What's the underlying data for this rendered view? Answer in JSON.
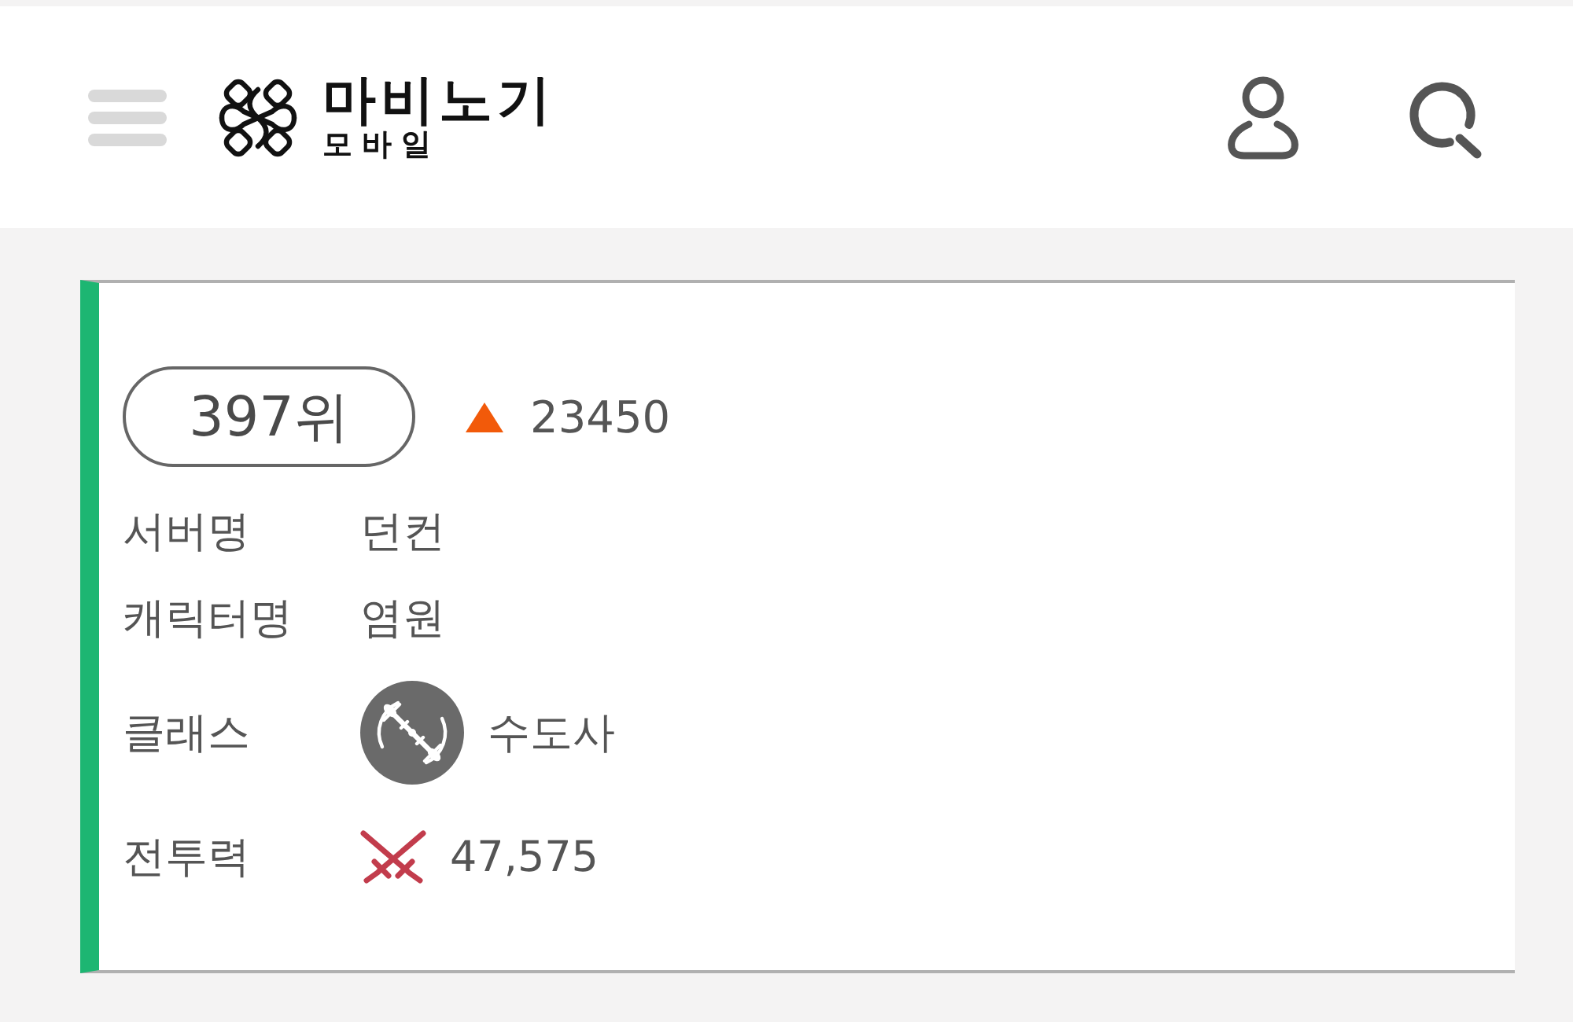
{
  "header": {
    "logo": {
      "title": "마비노기",
      "subtitle": "모바일"
    }
  },
  "ranking_card": {
    "rank": "397위",
    "change": {
      "increased": true,
      "value": "23450"
    },
    "fields": [
      {
        "kind": "text",
        "label": "서버명",
        "value": "던컨"
      },
      {
        "kind": "text",
        "label": "캐릭터명",
        "value": "염원"
      },
      {
        "kind": "class",
        "label": "클래스",
        "value": "수도사"
      },
      {
        "kind": "power",
        "label": "전투력",
        "value": "47,575"
      }
    ]
  }
}
